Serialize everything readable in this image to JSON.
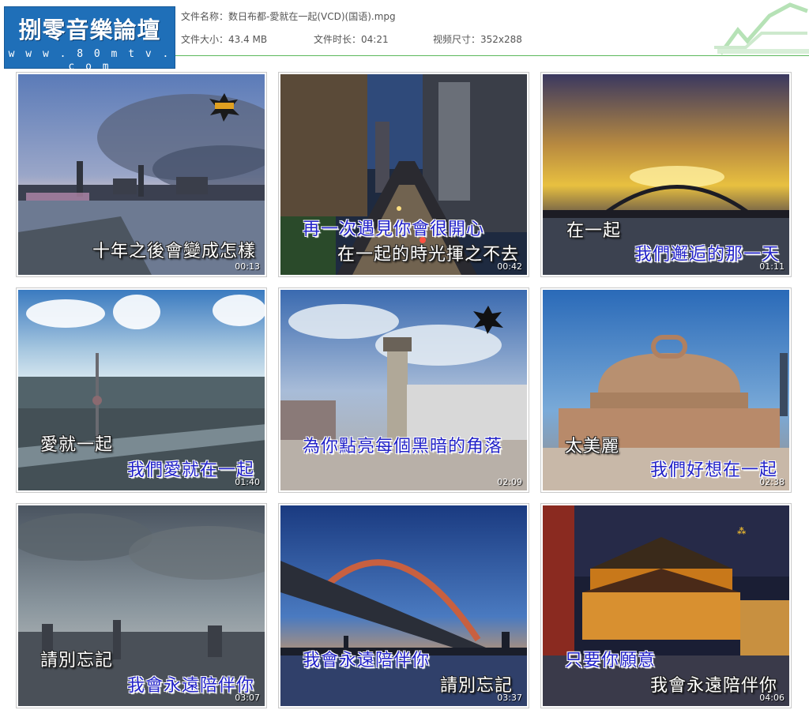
{
  "header": {
    "logo_title": "捌零音樂論壇",
    "logo_url": "w w w . 8 0 m t v . c o m",
    "file_name_label": "文件名称：",
    "file_name": "数日布都-愛就在一起(VCD)(国语).mpg",
    "file_size_label": "文件大小：",
    "file_size": "43.4 MB",
    "duration_label": "文件时长：",
    "duration": "04:21",
    "video_size_label": "视频尺寸：",
    "video_size": "352x288",
    "accent_color": "#5cb85c"
  },
  "thumbnails": [
    {
      "scene": "city-skyline-dusk",
      "lines": [
        {
          "text": "十年之後會變成怎樣",
          "color": "white"
        }
      ],
      "time": "00:13"
    },
    {
      "scene": "city-street-night-traffic",
      "lines": [
        {
          "text": "再一次遇見你會很開心",
          "color": "blue"
        },
        {
          "text": "在一起的時光揮之不去",
          "color": "white"
        }
      ],
      "time": "00:42"
    },
    {
      "scene": "bridge-sunset",
      "lines": [
        {
          "text": "在一起",
          "color": "white"
        },
        {
          "text": "我們邂逅的那一天",
          "color": "blue"
        }
      ],
      "time": "01:11"
    },
    {
      "scene": "aerial-city-clouds",
      "lines": [
        {
          "text": "愛就一起",
          "color": "white"
        },
        {
          "text": "我們愛就在一起",
          "color": "blue"
        }
      ],
      "time": "01:40"
    },
    {
      "scene": "clock-tower-station",
      "lines": [
        {
          "text": "為你點亮每個黑暗的角落",
          "color": "blue"
        }
      ],
      "time": "02:09"
    },
    {
      "scene": "museum-building",
      "lines": [
        {
          "text": "太美麗",
          "color": "white"
        },
        {
          "text": "我們好想在一起",
          "color": "blue"
        }
      ],
      "time": "02:38"
    },
    {
      "scene": "cloudy-skyline",
      "lines": [
        {
          "text": "請別忘記",
          "color": "white"
        },
        {
          "text": "我會永遠陪伴你",
          "color": "blue"
        }
      ],
      "time": "03:07"
    },
    {
      "scene": "arch-bridge-dusk",
      "lines": [
        {
          "text": "我會永遠陪伴你",
          "color": "blue"
        },
        {
          "text": "請別忘記",
          "color": "white"
        }
      ],
      "time": "03:37"
    },
    {
      "scene": "temple-lights-night",
      "lines": [
        {
          "text": "只要你願意",
          "color": "blue"
        },
        {
          "text": "我會永遠陪伴你",
          "color": "white"
        }
      ],
      "time": "04:06"
    }
  ]
}
